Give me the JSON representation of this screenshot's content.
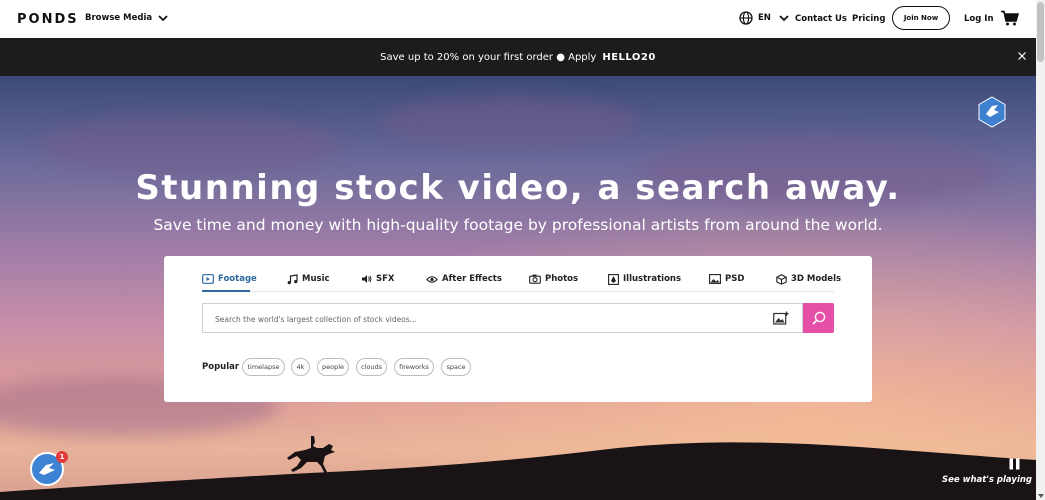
{
  "header": {
    "logo": "PONDS",
    "browse_label": "Browse Media",
    "language": "EN",
    "contact_label": "Contact Us",
    "pricing_label": "Pricing",
    "join_label": "Join Now",
    "login_label": "Log In"
  },
  "promo": {
    "text": "Save up to 20% on your first order ● Apply",
    "code": "HELLO20"
  },
  "hero": {
    "title": "Stunning stock video, a search away.",
    "subtitle": "Save time and money with high-quality footage by professional artists from around the world."
  },
  "search": {
    "tabs": [
      {
        "label": "Footage",
        "icon": "film-icon",
        "active": true
      },
      {
        "label": "Music",
        "icon": "music-note-icon",
        "active": false
      },
      {
        "label": "SFX",
        "icon": "speaker-icon",
        "active": false
      },
      {
        "label": "After Effects",
        "icon": "eye-icon",
        "active": false
      },
      {
        "label": "Photos",
        "icon": "camera-icon",
        "active": false
      },
      {
        "label": "Illustrations",
        "icon": "pen-icon",
        "active": false
      },
      {
        "label": "PSD",
        "icon": "image-icon",
        "active": false
      },
      {
        "label": "3D Models",
        "icon": "cube-icon",
        "active": false
      }
    ],
    "placeholder": "Search the world's largest collection of stock videos...",
    "popular_label": "Popular",
    "popular_tags": [
      "timelapse",
      "4k",
      "people",
      "clouds",
      "fireworks",
      "space"
    ]
  },
  "widgets": {
    "chat_badge": "1",
    "playing_label": "See what's playing"
  },
  "colors": {
    "accent": "#e64fa8",
    "tab_active": "#2d6aa0",
    "promo_bg": "#1c1c1e"
  }
}
